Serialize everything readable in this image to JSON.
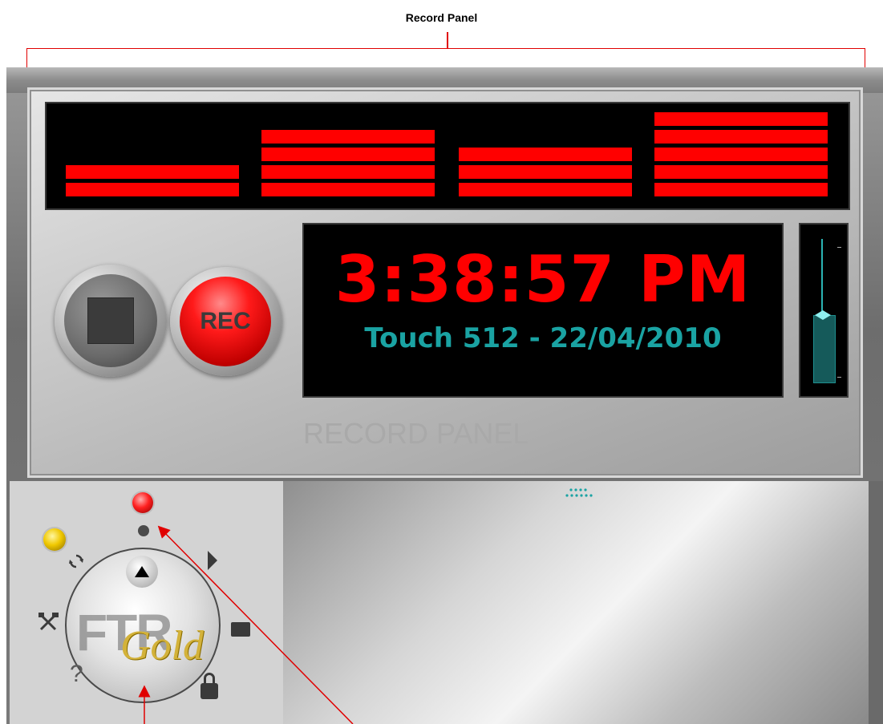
{
  "annotations": {
    "title": "Record Panel"
  },
  "record_panel": {
    "clock": "3:38:57 PM",
    "subtitle": "Touch 512 - 22/04/2010",
    "caption": "RECORD PANEL",
    "rec_label": "REC"
  },
  "level_meters": [
    {
      "label": "channel-1",
      "bars": 2
    },
    {
      "label": "channel-2",
      "bars": 4
    },
    {
      "label": "channel-3",
      "bars": 3
    },
    {
      "label": "channel-4",
      "bars": 5
    }
  ],
  "volume_level_fraction": 0.46,
  "controls": {
    "icons": [
      "sync-icon",
      "play-icon",
      "tools-icon",
      "folder-icon",
      "help-icon",
      "lock-icon",
      "up-arrow-icon"
    ],
    "brand": {
      "ftr": "FTR",
      "gold": "Gold"
    },
    "help_glyph": "?"
  },
  "status_leds": {
    "red": "#ff2020",
    "yellow": "#f0c800"
  },
  "colors": {
    "meter_red": "#ff0000",
    "accent_teal": "#1aa3a3",
    "annotation_red": "#e00000"
  }
}
